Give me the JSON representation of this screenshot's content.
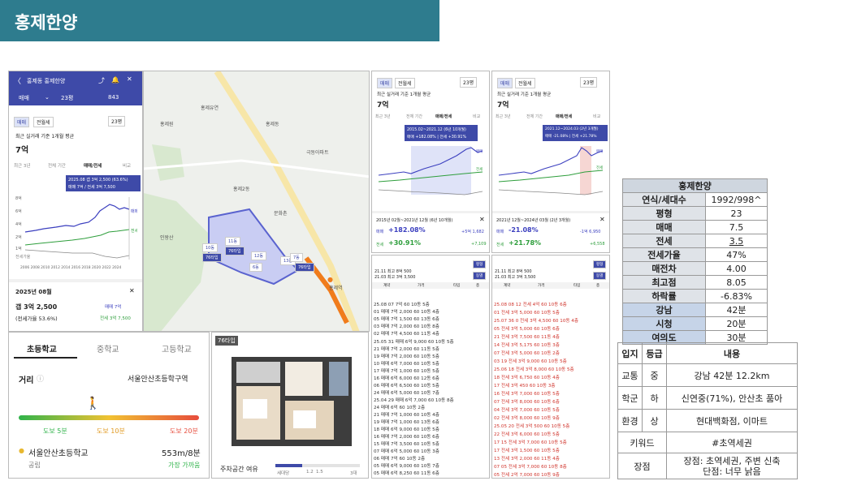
{
  "slide_title": "홍제한양",
  "app": {
    "back": "〈",
    "title": "홍제동 홍제한양",
    "trade": "매매",
    "size": "23평",
    "count": "843",
    "tab_trade": "매매",
    "tab_rent": "전월세",
    "size_select": "23평",
    "price_caption": "최근 실거래 기준 1개월 평균",
    "price": "7억",
    "ranges": [
      "최근 3년",
      "전체 기간",
      "매매/전세",
      "비교"
    ],
    "tooltip_line1": "2025.08 갭 3억 2,500 (63.6%)",
    "tooltip_line2": "매매 7억 / 전세 3억 7,500",
    "y_ticks": [
      "8억",
      "6억",
      "4억",
      "2억",
      "1억"
    ],
    "x_ticks": "2006 2008 2010 2012 2014 2016 2018 2020 2022 2024",
    "label_trade": "매매",
    "label_jeonse": "전세",
    "label_gap": "전세가율",
    "period": "2025년 08월",
    "gap": "갭 3억 2,500",
    "ratio": "(전세가율 53.6%)",
    "trade_val": "매매 7억",
    "jeonse_val": "전세 3억 7,500"
  },
  "map": {
    "labels": [
      "홍제동",
      "극동아파트",
      "홍제2동",
      "홍제원",
      "홍제유연",
      "문화촌",
      "인왕산",
      "홍제역"
    ],
    "blocks": [
      "10동",
      "11동",
      "13동",
      "7동",
      "6동",
      "12동",
      "76타입",
      "76타입",
      "76타입"
    ],
    "color_route": "#f07c1c"
  },
  "chart2": {
    "tab_trade": "매매",
    "tab_rent": "전월세",
    "size": "23평",
    "caption": "최근 실거래 기준 1개월 평균",
    "price": "7억",
    "ranges": [
      "최근 3년",
      "전체 기간",
      "매매/전세",
      "비교"
    ],
    "tooltip_line1": "2015.02~2021.12 (6년 10개월)",
    "tooltip_line2": "매매 +182.08% | 전세 +30.91%",
    "label_trade": "매매",
    "label_jeonse": "전세",
    "period": "2015년 02월~2021년 12월 (6년 10개월)",
    "trade_pct": "+182.08%",
    "trade_abs": "+5억 1,682",
    "jeonse_pct": "+30.91%",
    "jeonse_abs": "+7,109",
    "trade_label": "매매",
    "jeonse_label": "전세"
  },
  "chart3": {
    "tab_trade": "매매",
    "tab_rent": "전월세",
    "size": "23평",
    "caption": "최근 실거래 기준 1개월 평균",
    "price": "7억",
    "ranges": [
      "최근 3년",
      "전체 기간",
      "매매/전세",
      "비교"
    ],
    "tooltip_line1": "2021.12~2024.03 (2년 3개월)",
    "tooltip_line2": "매매 -21.08% | 전세 +21.78%",
    "label_trade": "매매",
    "label_jeonse": "전세",
    "period": "2021년 12월~2024년 03월 (2년 3개월)",
    "trade_pct": "-21.08%",
    "trade_abs": "-1억 6,950",
    "jeonse_pct": "+21.78%",
    "jeonse_abs": "+6,558",
    "trade_label": "매매",
    "jeonse_label": "전세"
  },
  "tx1": {
    "summary1": "21.11 최고 8억 500",
    "summary2": "21.03 최고 3억 3,500",
    "btn": "평형",
    "btn2": "동별",
    "headers": [
      "계약",
      "가격",
      "타입",
      "층"
    ],
    "rows": [
      "25.08  07   7억            60  10동  5층",
      "       01   매매 7억 2,000   60  10동  4층",
      "       05   매매 7억 1,500   60  13동  6층",
      "       03   매매 7억 2,000   60  10동  8층",
      "       02   매매 7억 4,500   60  11동  4층",
      "25.05  31   매매 6억 9,000   60  10동  5층",
      "       21   매매 7억 2,000   60  11동  5층",
      "       19   매매 7억 2,000   60  10동  5층",
      "       10   매매 6억 7,000   60  10동  5층",
      "       17   매매 7억 1,000   60  10동  5층",
      "       16   매매 6억 6,000   60  12동  6층",
      "       06   매매 6억 6,500   60  10동  5층",
      "       24   매매 6억 5,000   60  10동  7층",
      "25.04  29   매매 6억 7,000   60  10동  8층",
      "       24   매매 6억        60  10동  2층",
      "       21   매매 7억 1,000   60  10동  4층",
      "       19   매매 7억 1,000   60  13동  6층",
      "       18   매매 6억 9,000   60  10동  5층",
      "       16   매매 7억 2,000   60  10동  6층",
      "       15   매매 7억 3,500   60  10동  5층",
      "       07   매매 6억 5,000   60  10동  3층",
      "       06   매매 7억        60  10동  2층",
      "       05   매매 6억 9,000   60  10동  7층",
      "       05   매매 6억 8,250   60  11동  6층"
    ]
  },
  "tx2": {
    "summary1": "21.11 최고 8억 500",
    "summary2": "21.03 최고 3억 3,500",
    "btn": "평형",
    "btn2": "동별",
    "headers": [
      "계약",
      "가격",
      "타입",
      "층"
    ],
    "rows": [
      "25.08  08  12   전세 4억        60  10동  6층",
      "       01       전세 3억 5,000   60  10동  5층",
      "25.07  36  0    전세 3억 4,500   60  10동  4층",
      "       05       전세 3억 5,000   60  10동  6층",
      "       21       전세 3억 7,500   60  11동  4층",
      "       14       전세 3억 5,175   60  10동  3층",
      "       07       전세 3억 5,000   60  10동  2층",
      "       03   19  전세 3억 9,000   60  10동  5층",
      "25.06  18       전세 3억 8,000   60  10동  5층",
      "       18       전세 3억 6,750   60  10동  4층",
      "       17       전세 3억 450     60  10동  3층",
      "       16       전세 3억 7,000   60  10동  5층",
      "       07       전세 3억 8,000   60  10동  6층",
      "       04       전세 3억 7,000   60  10동  5층",
      "       02       전세 3억 8,000   60  10동  9층",
      "25.05  20       전세 3억 500     60  10동  5층",
      "       22       전세 3억 6,000   60  10동  5층",
      "       17   15  전세 3억 7,000   60  10동  5층",
      "       17       전세 3억 1,500   60  10동  5층",
      "       13       전세 3억 2,000   60  11동  4층",
      "       07   05  전세 3억 7,000   60  10동  8층",
      "       05       전세 2억 7,000   60  10동  9층"
    ]
  },
  "school": {
    "tabs": [
      "초등학교",
      "중학교",
      "고등학교"
    ],
    "distance_label": "거리",
    "district": "서울안산초등학구역",
    "walk5": "도보 5분",
    "walk10": "도보 10분",
    "walk20": "도보 20분",
    "school_name": "서울안산초등학교",
    "school_dist": "553m/8분",
    "school_type": "공립",
    "nearest": "가장 가까움"
  },
  "floorplan": {
    "type": "76타입",
    "parking_label": "주차공간 여유",
    "parking_sub": "세대당",
    "parking_ticks": [
      "1.2",
      "1.5",
      "3대"
    ]
  },
  "info_table": {
    "title": "홍제한양",
    "rows": [
      {
        "k": "연식/세대수",
        "v": "1992/998^"
      },
      {
        "k": "평형",
        "v": "23"
      },
      {
        "k": "매매",
        "v": "7.5"
      },
      {
        "k": "전세",
        "v": "3.5"
      },
      {
        "k": "전세가율",
        "v": "47%"
      },
      {
        "k": "매전차",
        "v": "4.00"
      },
      {
        "k": "최고점",
        "v": "8.05"
      },
      {
        "k": "하락률",
        "v": "-6.83%"
      },
      {
        "k": "강남",
        "v": "42분"
      },
      {
        "k": "시청",
        "v": "20분"
      },
      {
        "k": "여의도",
        "v": "30분"
      }
    ]
  },
  "loc_table": {
    "headers": [
      "입지",
      "등급",
      "내용"
    ],
    "rows": [
      {
        "a": "교통",
        "b": "중",
        "c": "강남 42분 12.2km"
      },
      {
        "a": "학군",
        "b": "하",
        "c": "신연중(71%), 안산초 품아"
      },
      {
        "a": "환경",
        "b": "상",
        "c": "현대백화점, 이마트"
      }
    ],
    "keyword_label": "키워드",
    "keyword": "#초역세권",
    "pros_label": "장점",
    "pros1": "장점: 초역세권, 주변 신축",
    "pros2": "단점: 너무 낡음"
  },
  "colors": {
    "title": "#2e7c8e",
    "trade": "#3b3fbf",
    "jeonse": "#2e9e3c",
    "gap": "#888888",
    "blue_row": "#c6d4e8"
  }
}
